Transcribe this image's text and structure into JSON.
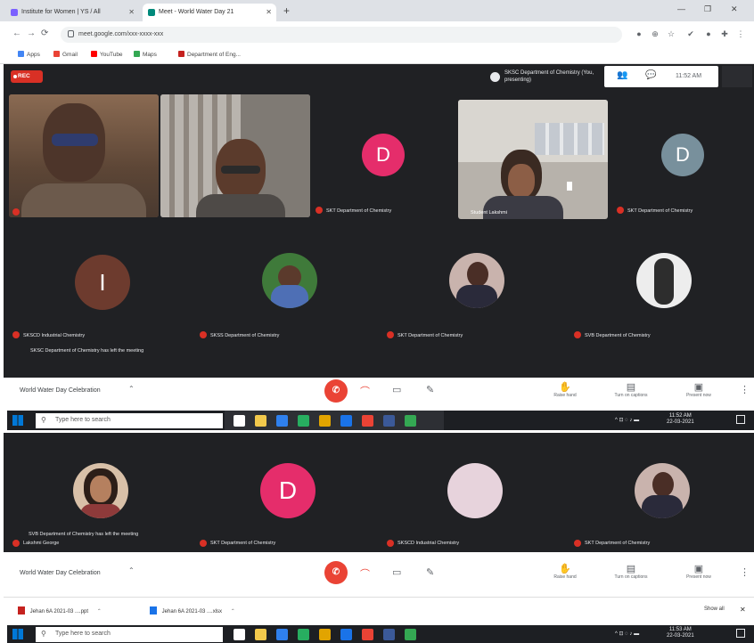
{
  "browser": {
    "tabs": [
      {
        "label": "Institute for Women | YS / All",
        "active": false,
        "favicon_color": "#7b61ff"
      },
      {
        "label": "Meet - World Water Day 21",
        "active": true,
        "favicon_color": "#00897b"
      }
    ],
    "new_tab_icon": "plus-icon",
    "url": "meet.google.com/xxx-xxxx-xxx",
    "bookmarks": [
      {
        "label": "Apps",
        "color": "#4285f4"
      },
      {
        "label": "Gmail",
        "color": "#ea4335"
      },
      {
        "label": "YouTube",
        "color": "#ff0000"
      },
      {
        "label": "Maps",
        "color": "#34a853"
      },
      {
        "label": "Department of Eng...",
        "color": "#c5221f"
      }
    ]
  },
  "meeting": {
    "rec_label": "REC",
    "presenting_text": "SKSC Department of Chemistry (You, presenting)",
    "clock": "11:52 AM",
    "top_tiles": [
      {
        "type": "video",
        "name": "",
        "bg": "#7a5a44"
      },
      {
        "type": "video",
        "name": "",
        "bg": "#9a8f86"
      },
      {
        "type": "avatar",
        "initial": "D",
        "color": "#e52d6b",
        "name": "SKT Department of Chemistry"
      },
      {
        "type": "video",
        "name": "Student Lakshmi",
        "bg": "#b7b2ab"
      },
      {
        "type": "avatar",
        "initial": "D",
        "color": "#78909c",
        "name": "SKT Department of Chemistry"
      }
    ],
    "mid_tiles": [
      {
        "type": "avatar",
        "initial": "I",
        "color": "#6d3b2e",
        "name": "SKSCD Industrial Chemistry"
      },
      {
        "type": "photo",
        "color": "#3f7a3a",
        "name": "SKSS Department of Chemistry"
      },
      {
        "type": "photo",
        "color": "#c9b3ad",
        "name": "SKT Department of Chemistry"
      },
      {
        "type": "photo",
        "color": "#ededed",
        "name": "SVB Department of Chemistry"
      }
    ],
    "chat_line": "SKSC Department of Chemistry has left the meeting",
    "controls": {
      "meeting_title": "World Water Day Celebration",
      "right_buttons": [
        {
          "icon": "raise-hand-icon",
          "label": "Raise hand"
        },
        {
          "icon": "captions-icon",
          "label": "Turn on captions"
        },
        {
          "icon": "present-icon",
          "label": "Present now"
        }
      ]
    }
  },
  "taskbar": {
    "search_placeholder": "Type here to search",
    "time": "11:52 AM",
    "date": "22-03-2021"
  },
  "meeting2": {
    "tiles": [
      {
        "type": "photo",
        "color": "#d8c0a8",
        "name": "SVB Department of Chemistry has left the meeting"
      },
      {
        "type": "avatar",
        "initial": "D",
        "color": "#e52d6b",
        "name": "SKT Department of Chemistry"
      },
      {
        "type": "avatar",
        "initial": "",
        "color": "#e7d3dc",
        "name": "SKSCD Industrial Chemistry"
      },
      {
        "type": "photo",
        "color": "#c9b3ad",
        "name": "SKT Department of Chemistry"
      }
    ],
    "sub_name": "Lakshmi George",
    "controls": {
      "meeting_title": "World Water Day Celebration"
    }
  },
  "downloads": [
    {
      "label": "Jehan 6A 2021-03 ....ppt"
    },
    {
      "label": "Jehan 6A 2021-03 ....xlsx"
    }
  ],
  "downloads_show_all": "Show all",
  "taskbar2": {
    "search_placeholder": "Type here to search",
    "time": "11:53 AM",
    "date": "22-03-2021"
  }
}
